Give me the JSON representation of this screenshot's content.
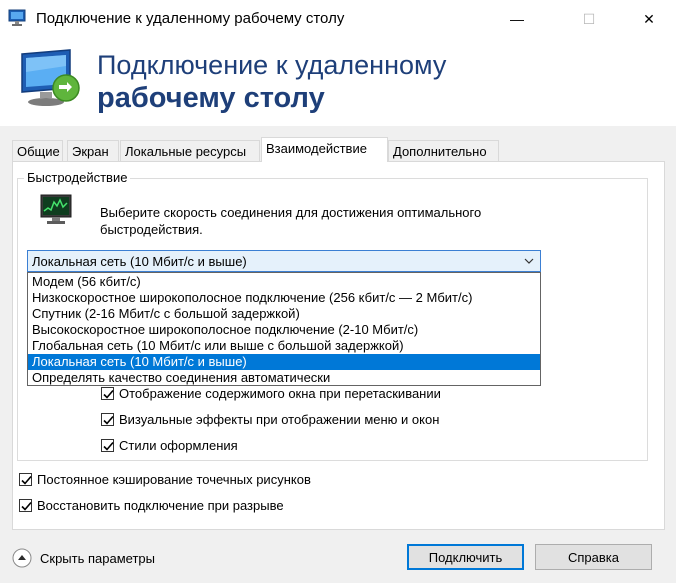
{
  "window": {
    "title": "Подключение к удаленному рабочему столу",
    "controls": {
      "minimize": "—",
      "maximize": "☐",
      "close": "✕"
    }
  },
  "header": {
    "line1": "Подключение к удаленному",
    "line2": "рабочему столу"
  },
  "tabs": [
    {
      "label": "Общие",
      "active": false
    },
    {
      "label": "Экран",
      "active": false
    },
    {
      "label": "Локальные ресурсы",
      "active": false
    },
    {
      "label": "Взаимодействие",
      "active": true
    },
    {
      "label": "Дополнительно",
      "active": false
    }
  ],
  "performance": {
    "group_label": "Быстродействие",
    "description": "Выберите скорость соединения для достижения оптимального быстродействия.",
    "combo_value": "Локальная сеть (10 Мбит/с и выше)",
    "options": [
      "Модем (56 кбит/с)",
      "Низкоскоростное широкополосное подключение (256 кбит/с — 2 Мбит/с)",
      "Спутник (2-16 Мбит/с с большой задержкой)",
      "Высокоскоростное широкополосное подключение (2-10 Мбит/с)",
      "Глобальная сеть (10 Мбит/с или выше с большой задержкой)",
      "Локальная сеть (10 Мбит/с и выше)",
      "Определять качество соединения автоматически"
    ],
    "selected_index": 5,
    "checkboxes": [
      {
        "label": "Отображение содержимого окна при перетаскивании",
        "checked": true
      },
      {
        "label": "Визуальные эффекты при отображении меню и окон",
        "checked": true
      },
      {
        "label": "Стили оформления",
        "checked": true
      }
    ]
  },
  "options": [
    {
      "label": "Постоянное кэширование точечных рисунков",
      "checked": true
    },
    {
      "label": "Восстановить подключение при разрыве",
      "checked": true
    }
  ],
  "footer": {
    "hide_params": "Скрыть параметры",
    "connect": "Подключить",
    "help": "Справка"
  },
  "colors": {
    "accent": "#0078d7",
    "header_text": "#1e3f79"
  }
}
